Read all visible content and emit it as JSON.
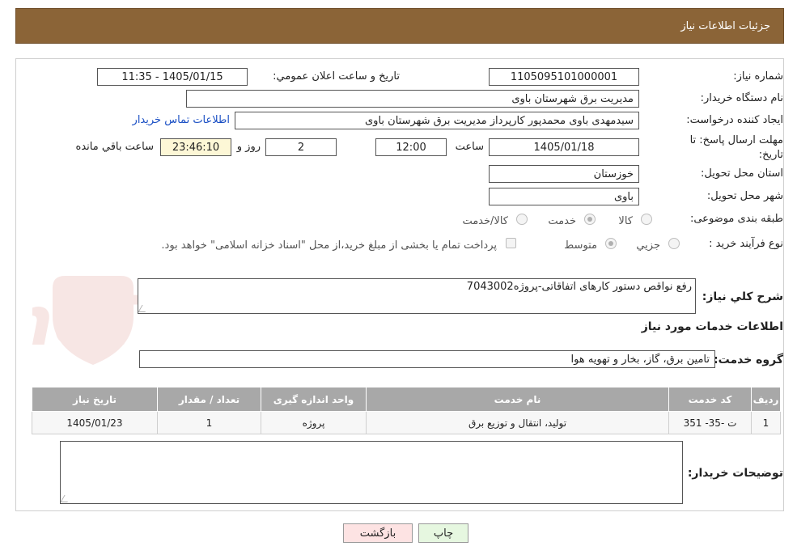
{
  "header": {
    "title": "جزئیات اطلاعات نیاز"
  },
  "fields": {
    "need_number": {
      "label": "شماره نیاز:",
      "value": "1105095101000001"
    },
    "announce_datetime": {
      "label": "تاریخ و ساعت اعلان عمومي:",
      "value": "1405/01/15 - 11:35"
    },
    "buyer_org": {
      "label": "نام دستگاه خريدار:",
      "value": "مديريت برق شهرستان باوی"
    },
    "requester": {
      "label": "ايجاد کننده درخواست:",
      "value": "سیدمهدی باوی محمدپور کارپرداز مديريت برق شهرستان باوی"
    },
    "buyer_contact_link": "اطلاعات تماس خريدار",
    "deadline": {
      "label_line1": "مهلت ارسال پاسخ: تا",
      "label_line2": "تاريخ:",
      "date": "1405/01/18",
      "time_label": "ساعت",
      "time": "12:00",
      "days": "2",
      "days_label": "روز و",
      "remaining": "23:46:10",
      "remaining_label": "ساعت باقي مانده"
    },
    "province": {
      "label": "استان محل تحويل:",
      "value": "خوزستان"
    },
    "city": {
      "label": "شهر محل تحويل:",
      "value": "باوی"
    },
    "category": {
      "label": "طبقه بندی موضوعی:",
      "options": [
        "کالا",
        "خدمت",
        "کالا/خدمت"
      ],
      "selected": "خدمت"
    },
    "purchase_process": {
      "label": "نوع فرآيند خريد :",
      "options": [
        "جزيي",
        "متوسط"
      ],
      "selected": "متوسط",
      "payment_note": "پرداخت تمام يا بخشی از مبلغ خريد،از محل \"اسناد خزانه اسلامی\" خواهد بود."
    }
  },
  "description": {
    "label": "شرح کلي نياز:",
    "value": "رفع نواقص دستور کارهای اتفاقاتی-پروژه7043002"
  },
  "services_section": {
    "title": "اطلاعات خدمات مورد نياز",
    "group_label": "گروه خدمت:",
    "group_value": "تامين برق، گاز، بخار و تهويه هوا",
    "table": {
      "headers": [
        "رديف",
        "کد خدمت",
        "نام خدمت",
        "واحد اندازه گيری",
        "تعداد / مقدار",
        "تاريخ نياز"
      ],
      "rows": [
        [
          "1",
          "ت -35- 351",
          "توليد، انتقال و توزيع برق",
          "پروژه",
          "1",
          "1405/01/23"
        ]
      ]
    }
  },
  "buyer_notes": {
    "label": "توضيحات خريدار:",
    "value": ""
  },
  "buttons": {
    "print": "چاپ",
    "back": "بازگشت"
  },
  "colors": {
    "header_bg": "#8b6437",
    "table_header_bg": "#a8a8a8",
    "remaining_bg": "#fdf7d6",
    "back_btn_bg": "#fde3e3",
    "print_btn_bg": "#e6f7e0"
  }
}
